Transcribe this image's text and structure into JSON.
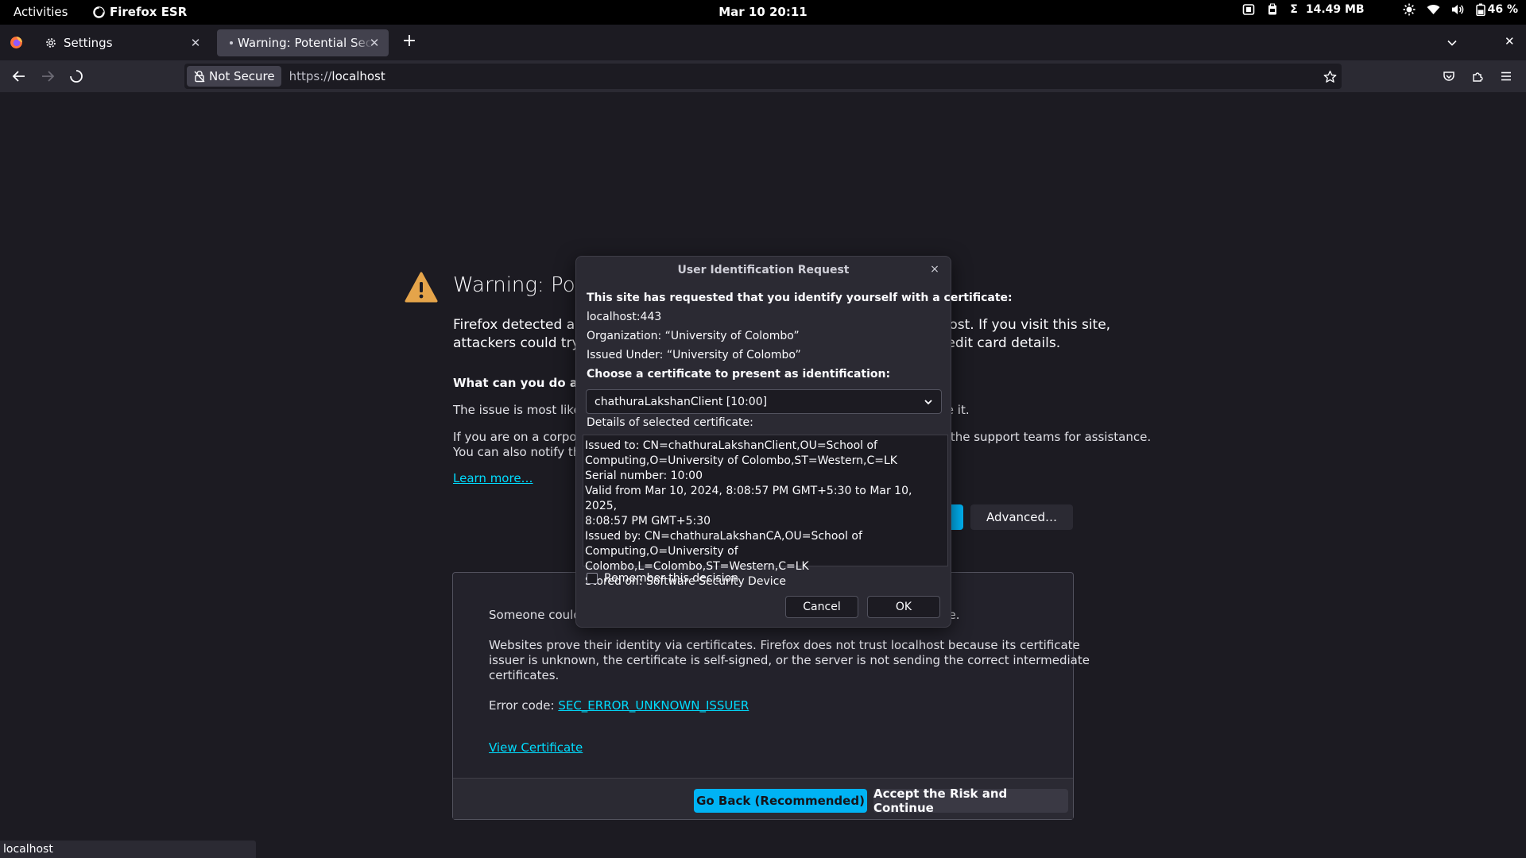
{
  "topbar": {
    "activities": "Activities",
    "app_name": "Firefox ESR",
    "clock": "Mar 10  20:11",
    "memory": "14.49 MB",
    "memory_icon": "Σ",
    "battery": "46 %"
  },
  "tabs": [
    {
      "label": "Settings",
      "icon": "gear-icon"
    },
    {
      "label": "Warning: Potential Security Risk Ahead",
      "icon": "loading-dot"
    }
  ],
  "navbar": {
    "not_secure": "Not Secure",
    "url_scheme": "https://",
    "url_host": "localhost"
  },
  "page": {
    "title": "Warning: Potential Security Risk Ahead",
    "intro_1": "Firefox detected a potential security threat and did not continue to localhost. If you visit this site,",
    "intro_2": "attackers could try to steal information like your passwords, emails, or credit card details.",
    "question": "What can you do about it?",
    "issue": "The issue is most likely with the website, and there is nothing you can do to resolve it.",
    "corporate_1": "If you are on a corporate network or using antivirus software, you can reach out to the support teams for assistance.",
    "corporate_2": "You can also notify the website’s administrator about the problem.",
    "learn_more": "Learn more…",
    "advanced_button": "Advanced…",
    "adv_someone": "Someone could be trying to impersonate the site and you should not continue.",
    "adv_websites_1": "Websites prove their identity via certificates. Firefox does not trust localhost because its certificate",
    "adv_websites_2": "issuer is unknown, the certificate is self-signed, or the server is not sending the correct intermediate",
    "adv_websites_3": "certificates.",
    "error_code_label": "Error code: ",
    "error_code": "SEC_ERROR_UNKNOWN_ISSUER",
    "view_certificate": "View Certificate",
    "go_back": "Go Back (Recommended)",
    "accept_risk": "Accept the Risk and Continue"
  },
  "dialog": {
    "title": "User Identification Request",
    "close": "×",
    "intro": "This site has requested that you identify yourself with a certificate:",
    "host": "localhost:443",
    "organization": "Organization: “University of Colombo”",
    "issued_under": "Issued Under: “University of Colombo”",
    "choose": "Choose a certificate to present as identification:",
    "selected_cert": "chathuraLakshanClient [10:00]",
    "details_label": "Details of selected certificate:",
    "details": [
      "Issued to: CN=chathuraLakshanClient,OU=School of",
      "Computing,O=University of Colombo,ST=Western,C=LK",
      "Serial number: 10:00",
      "Valid from Mar 10, 2024, 8:08:57 PM GMT+5:30 to Mar 10, 2025,",
      "8:08:57 PM GMT+5:30",
      "Issued by: CN=chathuraLakshanCA,OU=School of",
      "Computing,O=University of Colombo,L=Colombo,ST=Western,C=LK",
      "Stored on: Software Security Device"
    ],
    "remember": "Remember this decision",
    "cancel": "Cancel",
    "ok": "OK"
  },
  "statusbar": "localhost"
}
